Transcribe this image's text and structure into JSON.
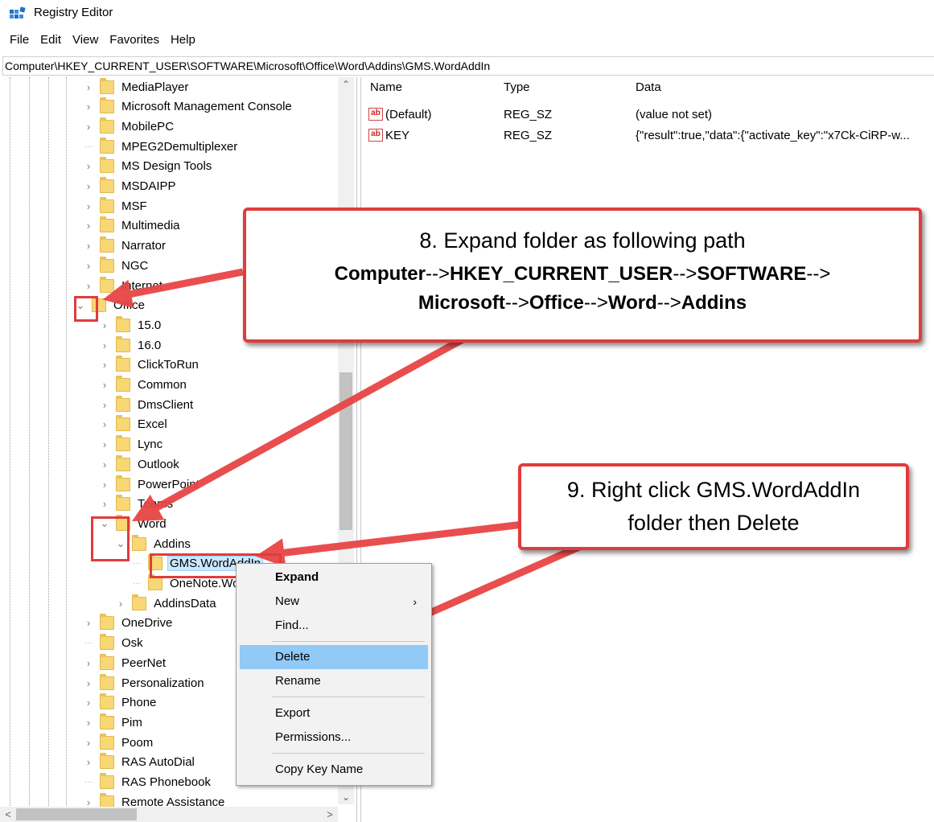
{
  "window": {
    "title": "Registry Editor"
  },
  "menu": [
    "File",
    "Edit",
    "View",
    "Favorites",
    "Help"
  ],
  "address": "Computer\\HKEY_CURRENT_USER\\SOFTWARE\\Microsoft\\Office\\Word\\Addins\\GMS.WordAddIn",
  "tree": [
    {
      "label": "MediaPlayer",
      "chev": ">"
    },
    {
      "label": "Microsoft Management Console",
      "chev": ">"
    },
    {
      "label": "MobilePC",
      "chev": ">"
    },
    {
      "label": "MPEG2Demultiplexer",
      "chev": ""
    },
    {
      "label": "MS Design Tools",
      "chev": ">"
    },
    {
      "label": "MSDAIPP",
      "chev": ">"
    },
    {
      "label": "MSF",
      "chev": ">"
    },
    {
      "label": "Multimedia",
      "chev": ">"
    },
    {
      "label": "Narrator",
      "chev": ">"
    },
    {
      "label": "NGC",
      "chev": ">"
    },
    {
      "label": "Internet",
      "chev": ">"
    },
    {
      "label": "Office",
      "chev": "v"
    },
    {
      "label": "15.0",
      "chev": ">"
    },
    {
      "label": "16.0",
      "chev": ">"
    },
    {
      "label": "ClickToRun",
      "chev": ">"
    },
    {
      "label": "Common",
      "chev": ">"
    },
    {
      "label": "DmsClient",
      "chev": ">"
    },
    {
      "label": "Excel",
      "chev": ">"
    },
    {
      "label": "Lync",
      "chev": ">"
    },
    {
      "label": "Outlook",
      "chev": ">"
    },
    {
      "label": "PowerPoint",
      "chev": ">"
    },
    {
      "label": "Teams",
      "chev": ">"
    },
    {
      "label": "Word",
      "chev": "v"
    },
    {
      "label": "Addins",
      "chev": "v"
    },
    {
      "label": "GMS.WordAddIn",
      "chev": ""
    },
    {
      "label": "OneNote.WordAddinTakeNotesService",
      "chev": ""
    },
    {
      "label": "AddinsData",
      "chev": ">"
    },
    {
      "label": "OneDrive",
      "chev": ">"
    },
    {
      "label": "Osk",
      "chev": ""
    },
    {
      "label": "PeerNet",
      "chev": ">"
    },
    {
      "label": "Personalization",
      "chev": ">"
    },
    {
      "label": "Phone",
      "chev": ">"
    },
    {
      "label": "Pim",
      "chev": ">"
    },
    {
      "label": "Poom",
      "chev": ">"
    },
    {
      "label": "RAS AutoDial",
      "chev": ">"
    },
    {
      "label": "RAS Phonebook",
      "chev": ""
    },
    {
      "label": "Remote Assistance",
      "chev": ">"
    }
  ],
  "list": {
    "headers": {
      "name": "Name",
      "type": "Type",
      "data": "Data"
    },
    "rows": [
      {
        "name": "(Default)",
        "type": "REG_SZ",
        "data": "(value not set)"
      },
      {
        "name": "KEY",
        "type": "REG_SZ",
        "data": "{\"result\":true,\"data\":{\"activate_key\":\"x7Ck-CiRP-w..."
      }
    ]
  },
  "context_menu": {
    "expand": "Expand",
    "new": "New",
    "find": "Find...",
    "delete": "Delete",
    "rename": "Rename",
    "export": "Export",
    "permissions": "Permissions...",
    "copy_key_name": "Copy Key Name"
  },
  "callout1": {
    "line1": "8. Expand folder as following path",
    "p1": "Computer",
    "p2": "HKEY_CURRENT_USER",
    "p3": "SOFTWARE",
    "p4": "Microsoft",
    "p5": "Office",
    "p6": "Word",
    "p7": "Addins",
    "sep": "-->"
  },
  "callout2": {
    "line1": "9. Right click GMS.WordAddIn",
    "line2": "folder then Delete"
  },
  "colors": {
    "accent_red": "#e03c3c",
    "menu_highlight": "#91c9f7",
    "folder": "#f8d775"
  }
}
